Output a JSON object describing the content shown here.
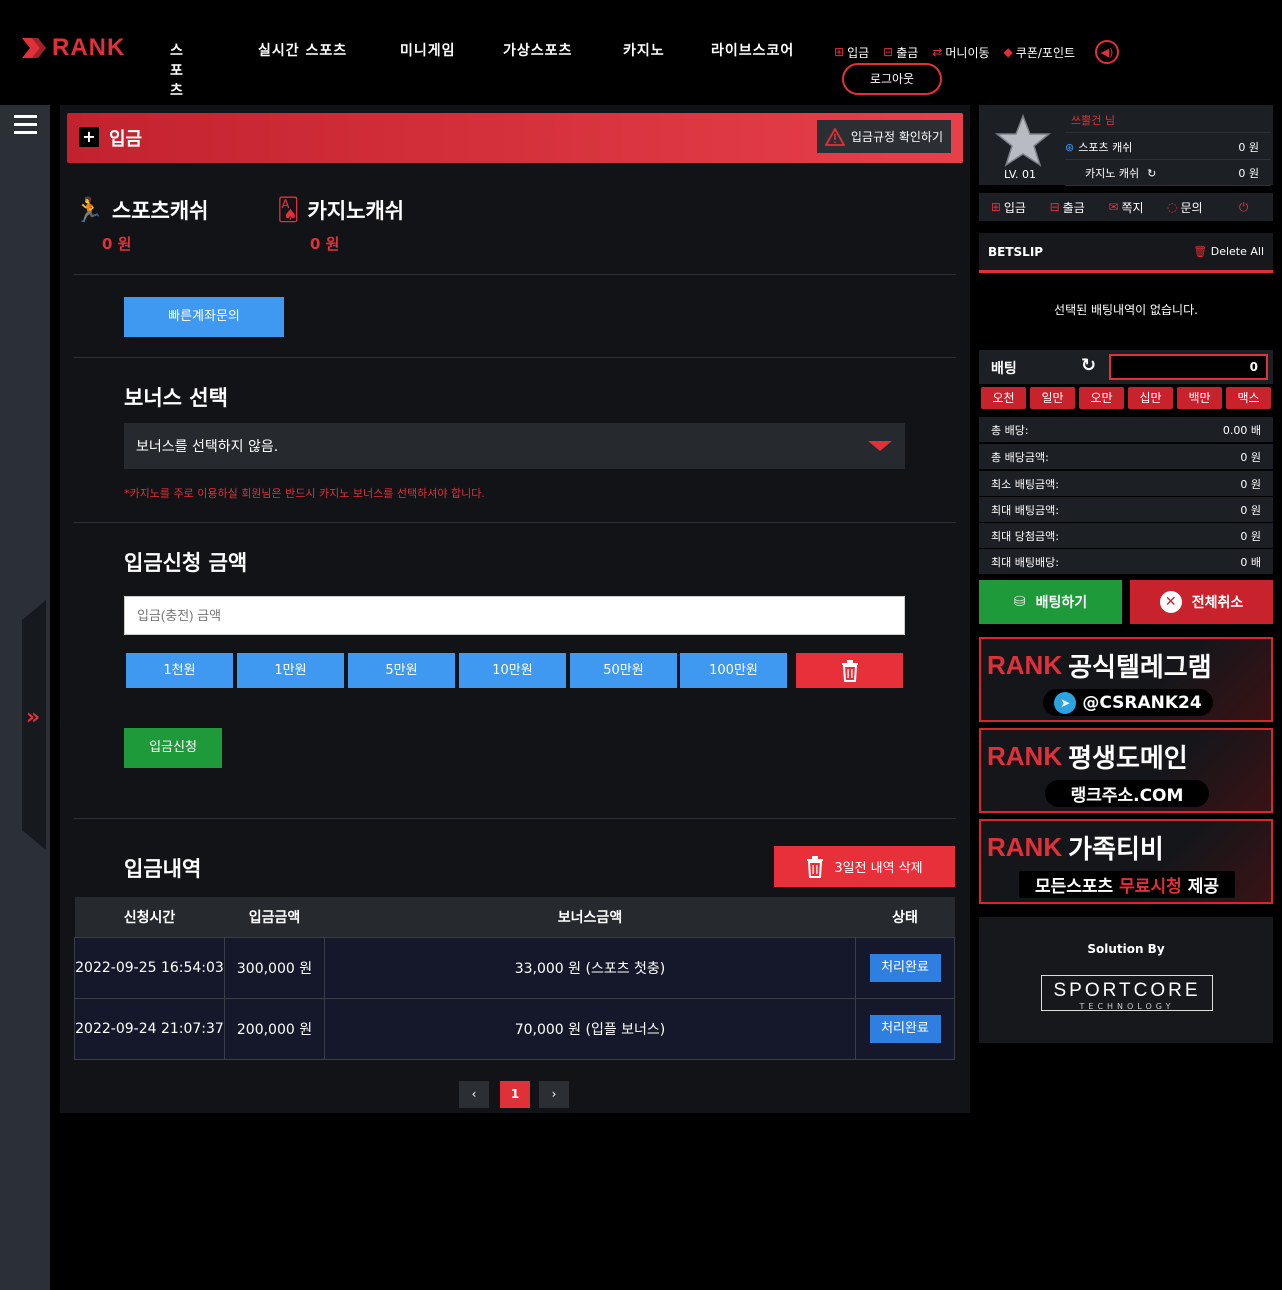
{
  "brand": {
    "name": "RANK"
  },
  "nav": [
    "스포츠",
    "실시간 스포츠",
    "미니게임",
    "가상스포츠",
    "카지노",
    "라이브스코어"
  ],
  "quick": {
    "deposit": "입금",
    "withdraw": "출금",
    "move": "머니이동",
    "coupon": "쿠폰/포인트",
    "logout": "로그아웃"
  },
  "page": {
    "title": "입금",
    "rules_button": "입금규정 확인하기"
  },
  "wallet": {
    "sports_label": "스포츠캐쉬",
    "sports_value": "0 원",
    "casino_label": "카지노캐쉬",
    "casino_value": "0 원"
  },
  "quick_account_button": "빠른계좌문의",
  "bonus": {
    "title": "보너스 선택",
    "selected": "보너스를 선택하지 않음.",
    "note": "*카지노를 주로 이용하실 회원님은 반드시 카지노 보너스를 선택하셔야 합니다."
  },
  "amount": {
    "title": "입금신청 금액",
    "placeholder": "입금(충전) 금액",
    "buttons": [
      "1천원",
      "1만원",
      "5만원",
      "10만원",
      "50만원",
      "100만원"
    ],
    "submit": "입금신청"
  },
  "history": {
    "title": "입금내역",
    "delete_button": "3일전 내역 삭제",
    "columns": [
      "신청시간",
      "입금금액",
      "보너스금액",
      "상태"
    ],
    "rows": [
      {
        "time": "2022-09-25 16:54:03",
        "amount": "300,000 원",
        "bonus": "33,000 원 (스포츠 첫충)",
        "status": "처리완료"
      },
      {
        "time": "2022-09-24 21:07:37",
        "amount": "200,000 원",
        "bonus": "70,000 원 (입플 보너스)",
        "status": "처리완료"
      }
    ]
  },
  "pager": {
    "prev": "‹",
    "current": "1",
    "next": "›"
  },
  "user": {
    "name": "쓰뿔건 님",
    "level": "LV. 01",
    "sports_label": "스포츠 캐쉬",
    "sports_value": "0 원",
    "casino_label": "카지노 캐쉬",
    "casino_value": "0 원"
  },
  "user_menu": [
    "입금",
    "출금",
    "쪽지",
    "문의"
  ],
  "betslip": {
    "title": "BETSLIP",
    "delete": "Delete All",
    "empty": "선택된 배팅내역이 없습니다.",
    "bet_label": "배팅",
    "bet_value": "0",
    "chips": [
      "오천",
      "일만",
      "오만",
      "십만",
      "백만",
      "맥스"
    ],
    "info": [
      {
        "label": "총 배당:",
        "value": "0.00 배"
      },
      {
        "label": "총 배당금액:",
        "value": "0 원"
      },
      {
        "label": "최소 배팅금액:",
        "value": "0 원"
      },
      {
        "label": "최대 배팅금액:",
        "value": "0 원"
      },
      {
        "label": "최대 당첨금액:",
        "value": "0 원"
      },
      {
        "label": "최대 배팅배당:",
        "value": "0 배"
      }
    ],
    "bet_button": "배팅하기",
    "cancel_button": "전체취소"
  },
  "banners": [
    {
      "brand": "RANK",
      "title": "공식텔레그램",
      "sub": "@CSRANK24"
    },
    {
      "brand": "RANK",
      "title": "평생도메인",
      "sub": "랭크주소.COM"
    },
    {
      "brand": "RANK",
      "title": "가족티비",
      "sub_a": "모든스포츠",
      "sub_b": "무료시청",
      "sub_c": "제공"
    }
  ],
  "solution": {
    "label": "Solution By",
    "name": "SPORTCORE",
    "tagline": "TECHNOLOGY"
  },
  "colors": {
    "accent": "#e0303a",
    "blue": "#3f99f0",
    "green": "#1f9a3a"
  }
}
